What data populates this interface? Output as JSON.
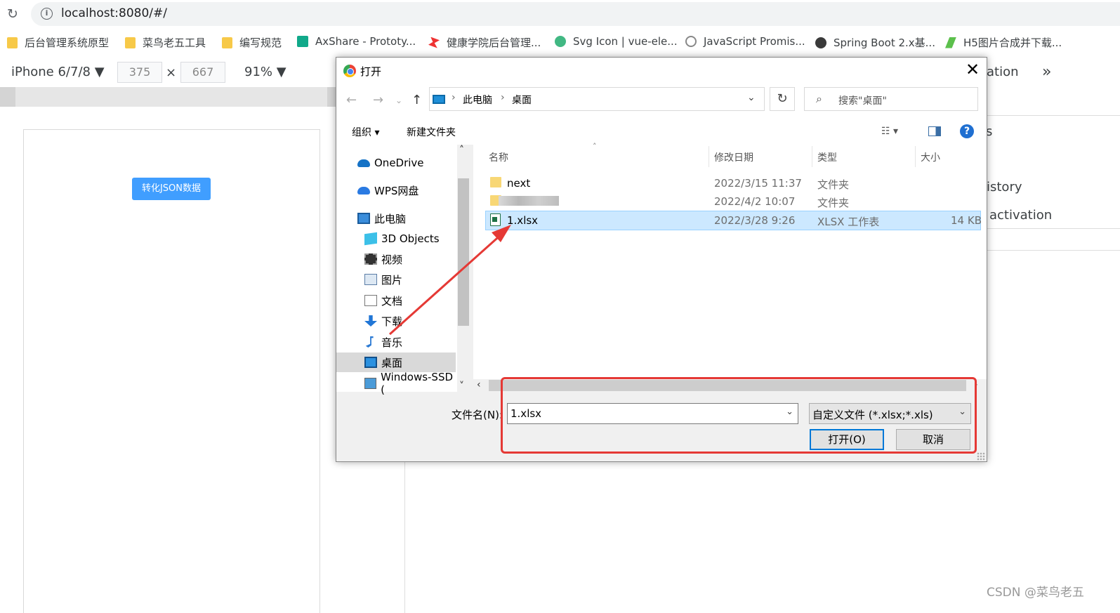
{
  "browser": {
    "url": "localhost:8080/#/",
    "bookmarks": [
      {
        "label": "后台管理系统原型",
        "icon": "folder-icon"
      },
      {
        "label": "菜鸟老五工具",
        "icon": "folder-icon"
      },
      {
        "label": "编写规范",
        "icon": "folder-icon"
      },
      {
        "label": "AxShare - Prototy...",
        "icon": "axshare-icon"
      },
      {
        "label": "健康学院后台管理...",
        "icon": "health-icon"
      },
      {
        "label": "Svg Icon | vue-ele...",
        "icon": "vue-icon"
      },
      {
        "label": "JavaScript Promis...",
        "icon": "js-icon"
      },
      {
        "label": "Spring Boot 2.x基...",
        "icon": "springboot-icon"
      },
      {
        "label": "H5图片合成并下载...",
        "icon": "h5-icon"
      }
    ]
  },
  "device_toolbar": {
    "device": "iPhone 6/7/8 ▼",
    "width": "375",
    "times": "×",
    "height": "667",
    "zoom": "91% ▼",
    "right_partial": "ation",
    "more": "»"
  },
  "app": {
    "convert_button": "转化JSON数据"
  },
  "devtools_right": {
    "partial_s": "s",
    "history": "istory",
    "activation": "activation"
  },
  "dialog": {
    "title": "打开",
    "close": "✕",
    "path": [
      "此电脑",
      "桌面"
    ],
    "search_placeholder": "搜索\"桌面\"",
    "organize": "组织 ▾",
    "new_folder": "新建文件夹",
    "help": "?",
    "sidebar": [
      {
        "label": "OneDrive",
        "icon": "onedrive-icon",
        "indent": 1
      },
      {
        "label": "WPS网盘",
        "icon": "wps-cloud-icon",
        "indent": 1
      },
      {
        "label": "此电脑",
        "icon": "this-pc-icon",
        "indent": 1
      },
      {
        "label": "3D Objects",
        "icon": "3d-objects-icon",
        "indent": 2
      },
      {
        "label": "视频",
        "icon": "video-icon",
        "indent": 2
      },
      {
        "label": "图片",
        "icon": "picture-icon",
        "indent": 2
      },
      {
        "label": "文档",
        "icon": "document-icon",
        "indent": 2
      },
      {
        "label": "下载",
        "icon": "download-icon",
        "indent": 2
      },
      {
        "label": "音乐",
        "icon": "music-icon",
        "indent": 2
      },
      {
        "label": "桌面",
        "icon": "desktop-icon",
        "indent": 2,
        "selected": true
      },
      {
        "label": "Windows-SSD (",
        "icon": "drive-icon",
        "indent": 2
      }
    ],
    "columns": [
      "名称",
      "修改日期",
      "类型",
      "大小"
    ],
    "files": [
      {
        "name": "next",
        "date": "2022/3/15 11:37",
        "type": "文件夹",
        "size": "",
        "icon": "folder-icon"
      },
      {
        "name": "",
        "date": "2022/4/2 10:07",
        "type": "文件夹",
        "size": "",
        "icon": "folder-icon",
        "blurred": true
      },
      {
        "name": "1.xlsx",
        "date": "2022/3/28 9:26",
        "type": "XLSX 工作表",
        "size": "14 KB",
        "icon": "xlsx-icon",
        "selected": true
      }
    ],
    "filename_label": "文件名(N):",
    "filename_value": "1.xlsx",
    "filetype": "自定义文件 (*.xlsx;*.xls)",
    "open_button": "打开(O)",
    "cancel_button": "取消"
  },
  "watermark": "CSDN @菜鸟老五"
}
